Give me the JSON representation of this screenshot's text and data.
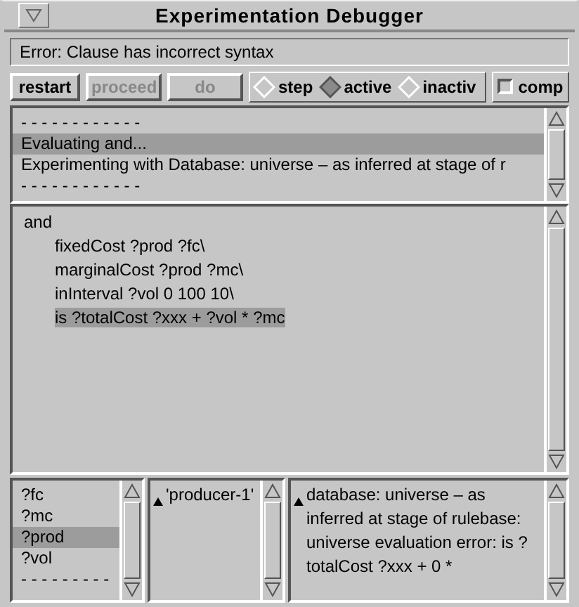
{
  "window": {
    "title": "Experimentation Debugger"
  },
  "error_message": "Error: Clause has incorrect syntax",
  "buttons": [
    {
      "label": "restart",
      "disabled": false
    },
    {
      "label": "proceed",
      "disabled": true
    },
    {
      "label": "do",
      "disabled": true
    }
  ],
  "modes": [
    {
      "label": "step",
      "selected": false
    },
    {
      "label": "active",
      "selected": true
    },
    {
      "label": "inactiv",
      "selected": false
    }
  ],
  "comp": {
    "label": "comp",
    "checked": false
  },
  "trace_lines": [
    {
      "text": "- - - - - - - - - - - -",
      "selected": false
    },
    {
      "text": "Evaluating and...",
      "selected": true
    },
    {
      "text": "Experimenting with Database: universe – as inferred at stage of r",
      "selected": false
    },
    {
      "text": "- - - - - - - - - - - -",
      "selected": false
    }
  ],
  "clause": {
    "text": "and",
    "selected": false,
    "children": [
      {
        "text": "fixedCost ?prod ?fc\\",
        "selected": false
      },
      {
        "text": "marginalCost ?prod ?mc\\",
        "selected": false
      },
      {
        "text": "inInterval ?vol 0 100 10\\",
        "selected": false
      },
      {
        "text": "is ?totalCost ?xxx + ?vol * ?mc",
        "selected": true
      }
    ]
  },
  "variables": [
    {
      "text": "?fc",
      "selected": false
    },
    {
      "text": "?mc",
      "selected": false
    },
    {
      "text": "?prod",
      "selected": true
    },
    {
      "text": "?vol",
      "selected": false
    },
    {
      "text": "- - - - - - - - -",
      "selected": false
    }
  ],
  "value_text": "'producer-1'",
  "message_text": "database: universe – as inferred at stage of rulebase: universe evaluation error: is ?totalCost ?xxx + 0 *"
}
